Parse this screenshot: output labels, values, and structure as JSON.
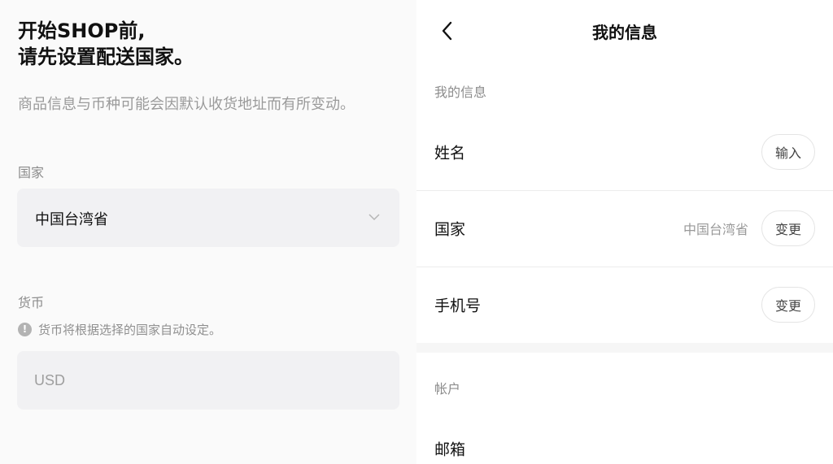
{
  "left": {
    "title_line1": "开始SHOP前,",
    "title_line2": "请先设置配送国家。",
    "subtitle": "商品信息与币种可能会因默认收货地址而有所变动。",
    "country_label": "国家",
    "country_value": "中国台湾省",
    "currency_label": "货币",
    "currency_notice": "货币将根据选择的国家自动设定。",
    "currency_value": "USD",
    "notice_icon_glyph": "!"
  },
  "right": {
    "header_title": "我的信息",
    "section_my_info": "我的信息",
    "rows": [
      {
        "label": "姓名",
        "value": "",
        "action": "输入"
      },
      {
        "label": "国家",
        "value": "中国台湾省",
        "action": "变更"
      },
      {
        "label": "手机号",
        "value": "",
        "action": "变更"
      }
    ],
    "section_account": "帐户",
    "email_label": "邮箱"
  }
}
